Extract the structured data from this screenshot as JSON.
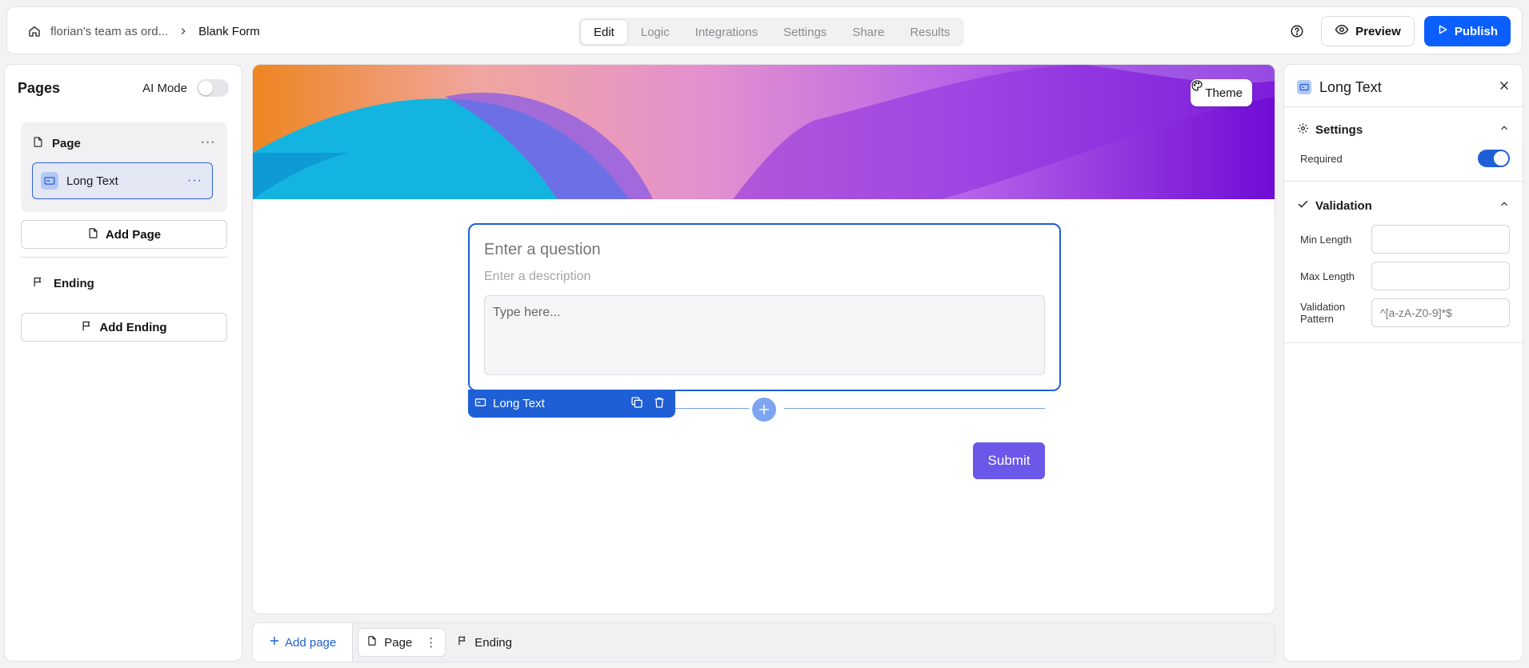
{
  "breadcrumb": {
    "team": "florian's team as ord...",
    "form": "Blank Form"
  },
  "tabs": [
    "Edit",
    "Logic",
    "Integrations",
    "Settings",
    "Share",
    "Results"
  ],
  "actions": {
    "preview": "Preview",
    "publish": "Publish"
  },
  "left_panel": {
    "title": "Pages",
    "ai_mode_label": "AI Mode",
    "page_label": "Page",
    "question_item": "Long Text",
    "add_page": "Add Page",
    "ending_label": "Ending",
    "add_ending": "Add Ending"
  },
  "canvas": {
    "theme_button": "Theme",
    "question_placeholder": "Enter a question",
    "description_placeholder": "Enter a description",
    "answer_placeholder": "Type here...",
    "question_type_tag": "Long Text",
    "submit_label": "Submit"
  },
  "bottom_bar": {
    "add_page": "Add page",
    "page": "Page",
    "ending": "Ending"
  },
  "right_panel": {
    "title": "Long Text",
    "settings_title": "Settings",
    "required_label": "Required",
    "required_on": true,
    "validation_title": "Validation",
    "min_length_label": "Min Length",
    "max_length_label": "Max Length",
    "pattern_label": "Validation Pattern",
    "pattern_placeholder": "^[a-zA-Z0-9]*$"
  },
  "colors": {
    "primary": "#1e5fd6",
    "publish": "#0b5fff",
    "submit": "#6b57e8"
  }
}
